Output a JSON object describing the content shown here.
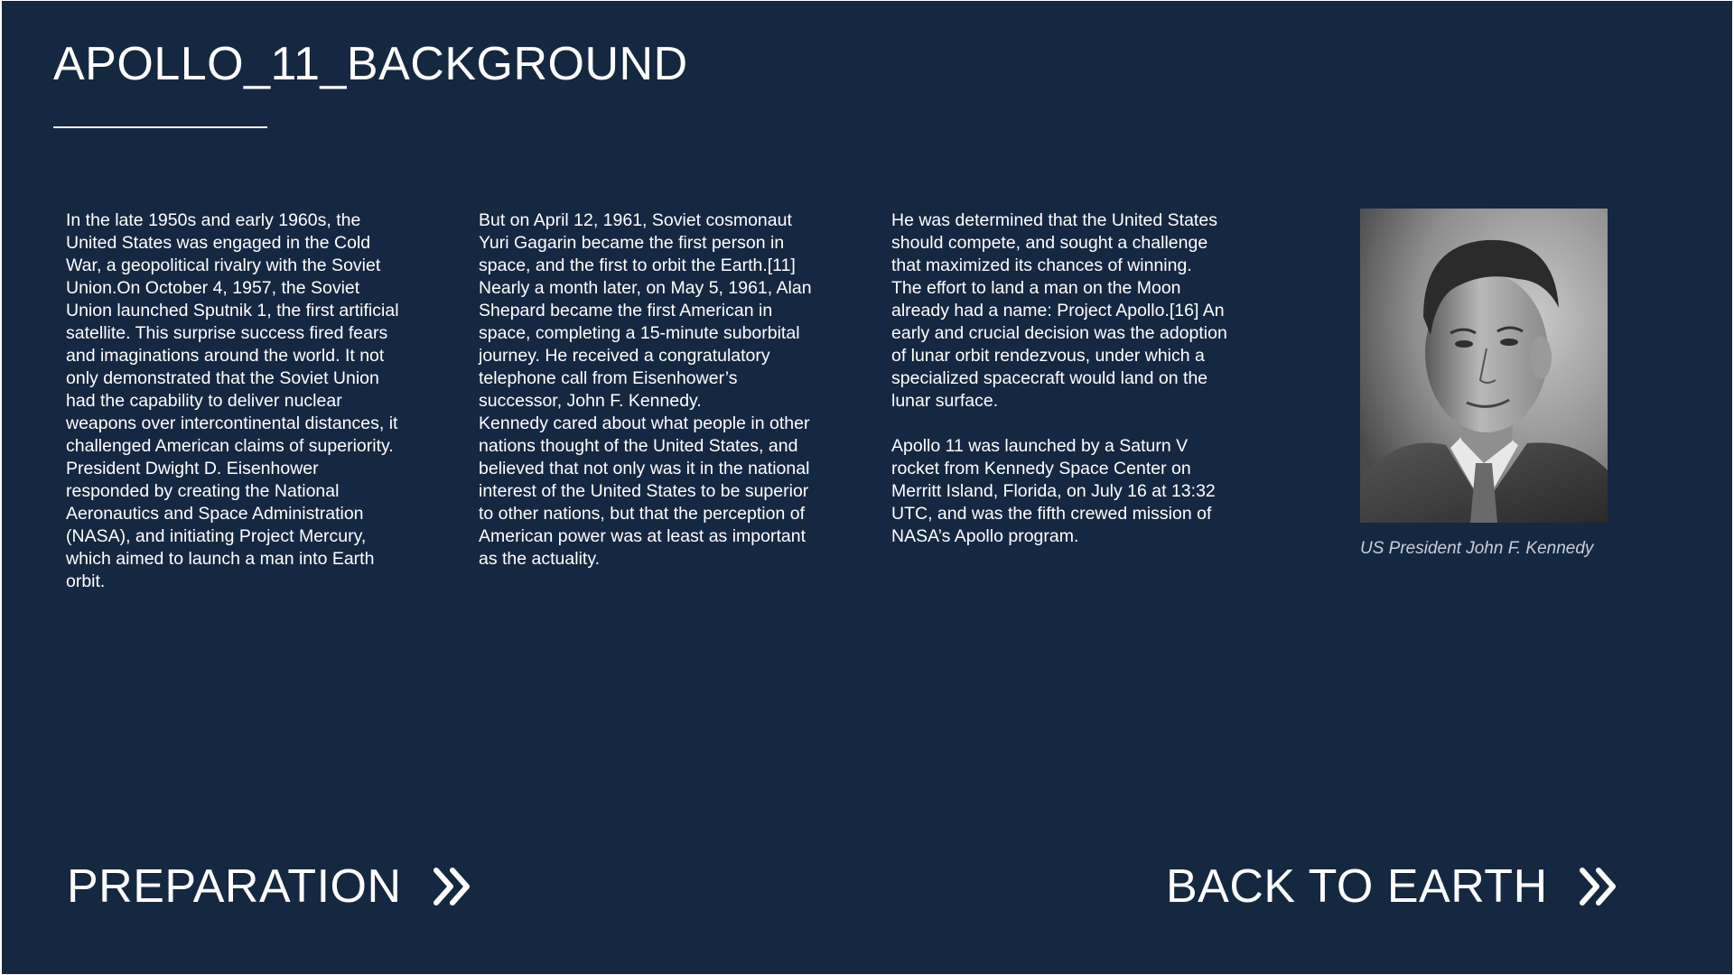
{
  "page": {
    "title": "APOLLO_11_BACKGROUND"
  },
  "columns": [
    {
      "text": "In the late 1950s and early 1960s, the\nUnited States was engaged in the Cold\nWar, a geopolitical rivalry with the Soviet\nUnion.On October 4, 1957, the Soviet\nUnion launched Sputnik 1, the first artificial\nsatellite. This surprise success fired fears\nand imaginations around the world. It not\nonly demonstrated that the Soviet Union\nhad the capability to deliver nuclear\nweapons over intercontinental distances, it\nchallenged American claims of  superiority.\nPresident Dwight D. Eisenhower\nresponded by creating the National\nAeronautics and Space Administration\n(NASA), and initiating Project Mercury,\nwhich aimed to launch a man into Earth\norbit."
    },
    {
      "text": "But on April 12, 1961, Soviet cosmonaut\nYuri Gagarin became the first person in\nspace, and the first to orbit the Earth.[11]\nNearly a month later, on May 5, 1961, Alan\nShepard became the first American in\nspace, completing a 15-minute suborbital\njourney. He received a congratulatory\ntelephone call from Eisenhower’s\nsuccessor, John F. Kennedy.\nKennedy cared about what people in other\nnations thought of the United States, and\nbelieved that not only was it in the national\ninterest of the United States to be superior\nto other nations, but that the perception of\nAmerican power was at least as important\nas the actuality."
    },
    {
      "text": "He was determined that the United States\nshould compete, and sought a challenge\nthat maximized its chances of winning.\nThe effort to land a man on the Moon\nalready had a name: Project Apollo.[16] An\nearly and crucial decision was the adoption\nof lunar orbit rendezvous, under which a\nspecialized spacecraft would land on the\nlunar surface.",
      "text2": "Apollo 11 was launched by a Saturn V\nrocket from Kennedy Space Center on\nMerritt Island, Florida,  on July 16 at 13:32\nUTC, and was the fifth crewed mission of\nNASA’s Apollo program."
    }
  ],
  "photo": {
    "caption": "US President John F. Kennedy"
  },
  "nav": {
    "prev_label": "PREPARATION",
    "next_label": "BACK TO EARTH",
    "icon": "double-chevron-right-icon"
  },
  "colors": {
    "background": "#152841",
    "text": "#ffffff",
    "caption": "#c9ced6"
  }
}
